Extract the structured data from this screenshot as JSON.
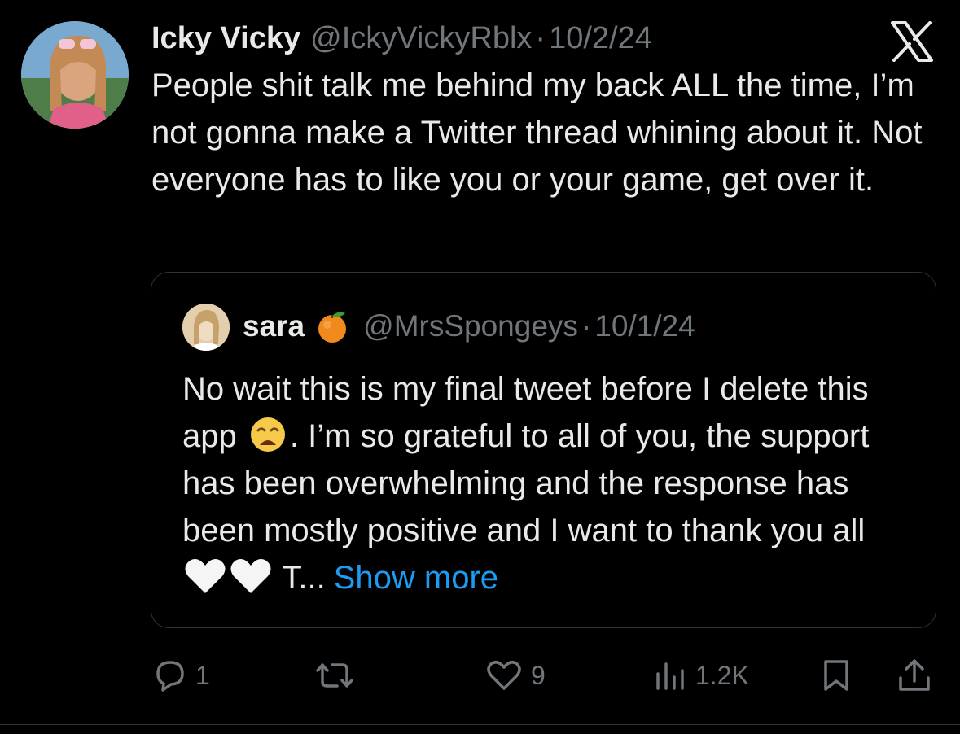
{
  "tweet": {
    "name": "Icky Vicky",
    "handle": "@IckyVickyRblx",
    "separator": "·",
    "date": "10/2/24",
    "text": "People shit talk me behind my back ALL the time, I’m not gonna make a Twitter thread whining about it. Not everyone has to like you or your game, get over it."
  },
  "quoted_tweet": {
    "name": "sara",
    "name_emoji": "tangerine-emoji",
    "handle": "@MrsSpongeys",
    "separator": "·",
    "date": "10/1/24",
    "text_part1": "No wait this is my final tweet before I delete this app",
    "text_emoji": "weary-face-emoji",
    "text_part2": ". I’m so grateful to all of you, the support has been overwhelming and the response has been mostly positive and I want to thank you all",
    "text_hearts": "white-heart-emoji",
    "text_part3": "T...",
    "show_more": "Show more"
  },
  "actions": {
    "replies": "1",
    "reposts": "",
    "likes": "9",
    "views": "1.2K"
  },
  "icons": {
    "brand": "x-logo-icon",
    "reply": "reply-icon",
    "repost": "repost-icon",
    "like": "heart-icon",
    "views": "views-icon",
    "bookmark": "bookmark-icon",
    "share": "share-icon"
  },
  "colors": {
    "background": "#000000",
    "text": "#e7e9ea",
    "secondary": "#71767b",
    "link": "#1d9bf0",
    "border": "#2f3336"
  }
}
